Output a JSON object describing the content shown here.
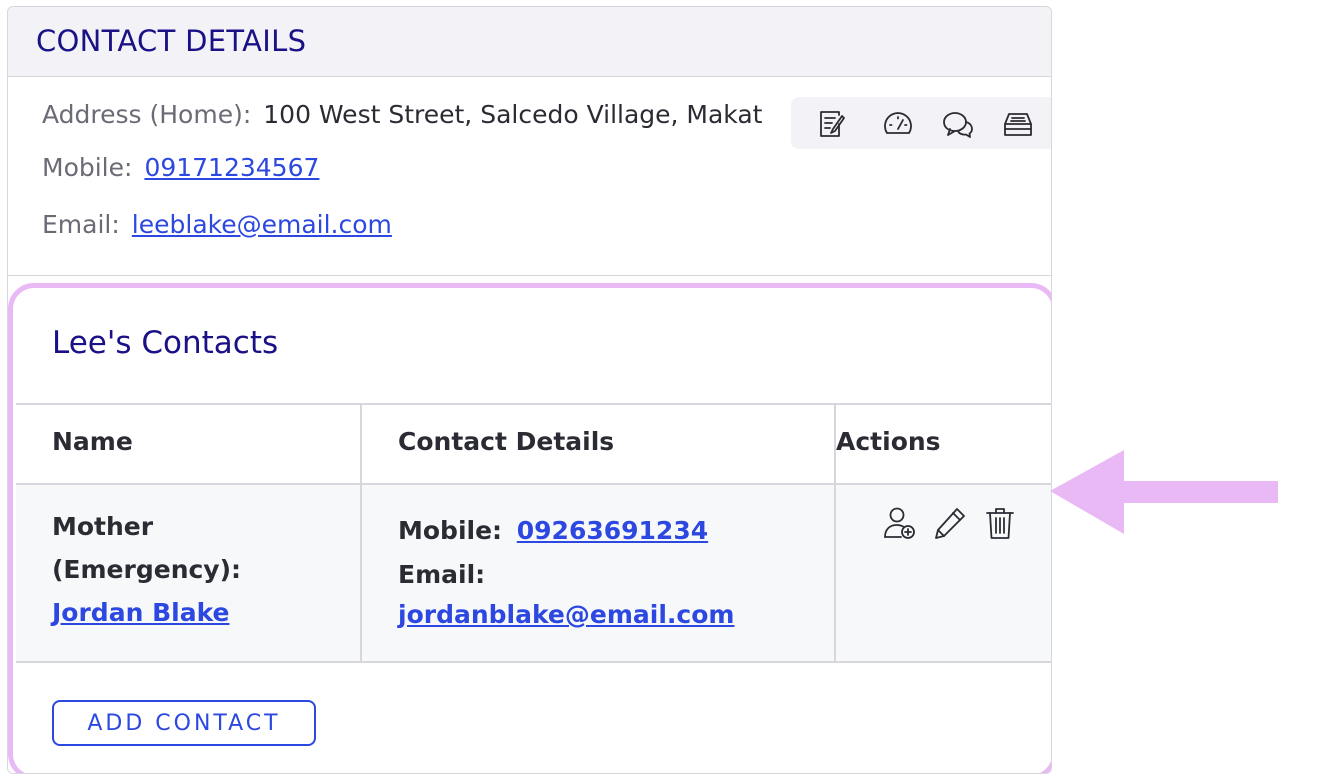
{
  "card": {
    "title": "CONTACT DETAILS",
    "address_label": "Address (Home):",
    "address_value": "100 West Street, Salcedo Village, Makat",
    "mobile_label": "Mobile:",
    "mobile_value": "09171234567",
    "email_label": "Email:",
    "email_value": "leeblake@email.com"
  },
  "toolbar": {
    "icons": [
      "edit-note-icon",
      "speedometer-icon",
      "chat-bubbles-icon",
      "archive-drawer-icon"
    ]
  },
  "contacts": {
    "title": "Lee's Contacts",
    "columns": [
      "Name",
      "Contact Details",
      "Actions"
    ],
    "rows": [
      {
        "relation_line1": "Mother",
        "relation_line2": "(Emergency):",
        "name": "Jordan Blake",
        "mobile_label": "Mobile:",
        "mobile": "09263691234",
        "email_label": "Email:",
        "email": "jordanblake@email.com"
      }
    ],
    "row_action_icons": [
      "add-user-icon",
      "pencil-icon",
      "trash-icon"
    ],
    "add_button_label": "ADD CONTACT"
  },
  "colors": {
    "accent": "#2c48e0",
    "title": "#1a1187",
    "highlight": "#e9b9f5"
  }
}
